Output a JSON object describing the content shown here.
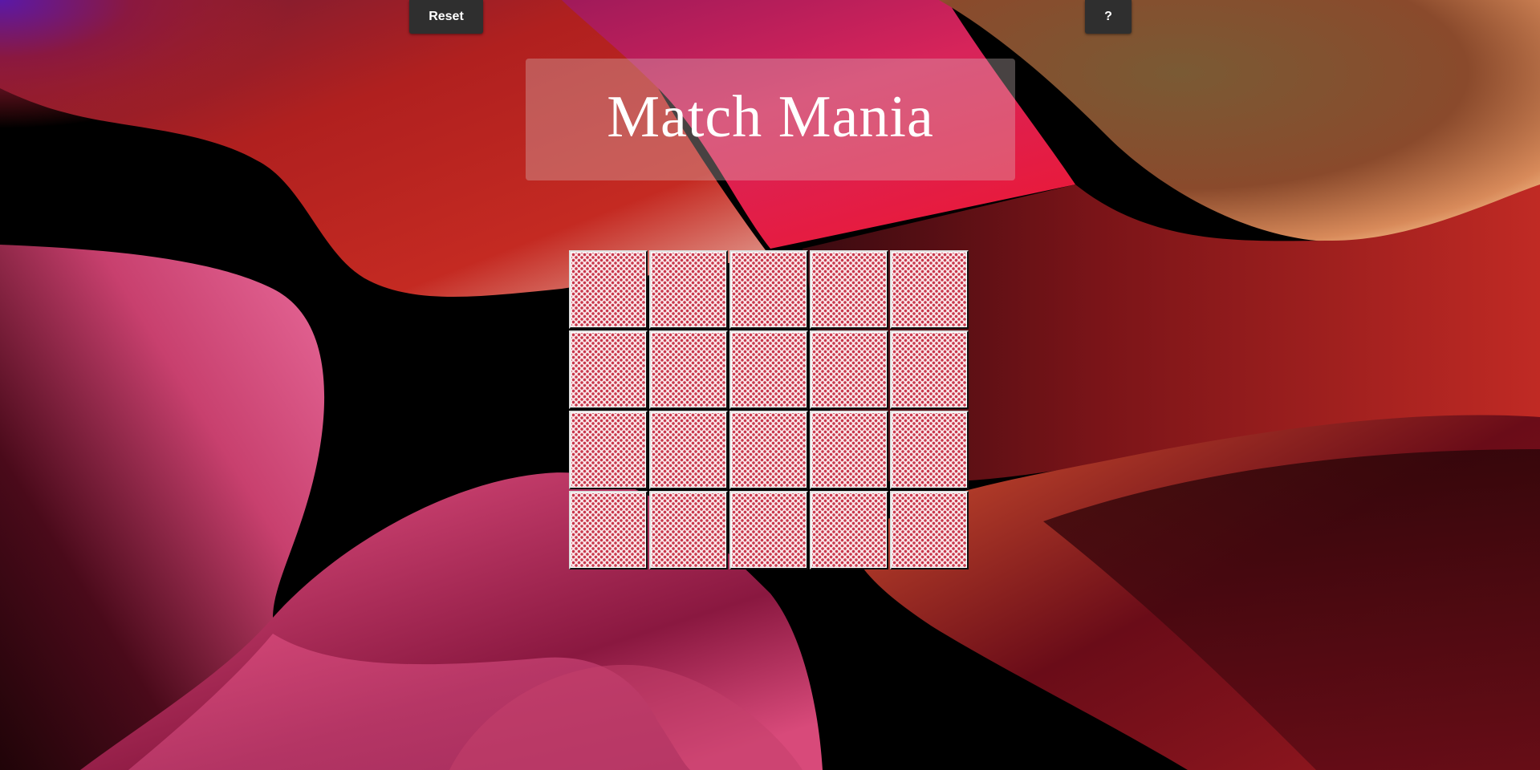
{
  "game": {
    "title": "Match Mania"
  },
  "toolbar": {
    "reset_label": "Reset",
    "help_label": "?"
  },
  "board": {
    "rows": 4,
    "columns": 5,
    "cards_face_down": 20,
    "card_back": "red-dot-pattern"
  },
  "colors": {
    "card_back_dot": "#c8384c",
    "card_back_base": "#fbe7ea",
    "button_bg": "#2f2f2f"
  }
}
